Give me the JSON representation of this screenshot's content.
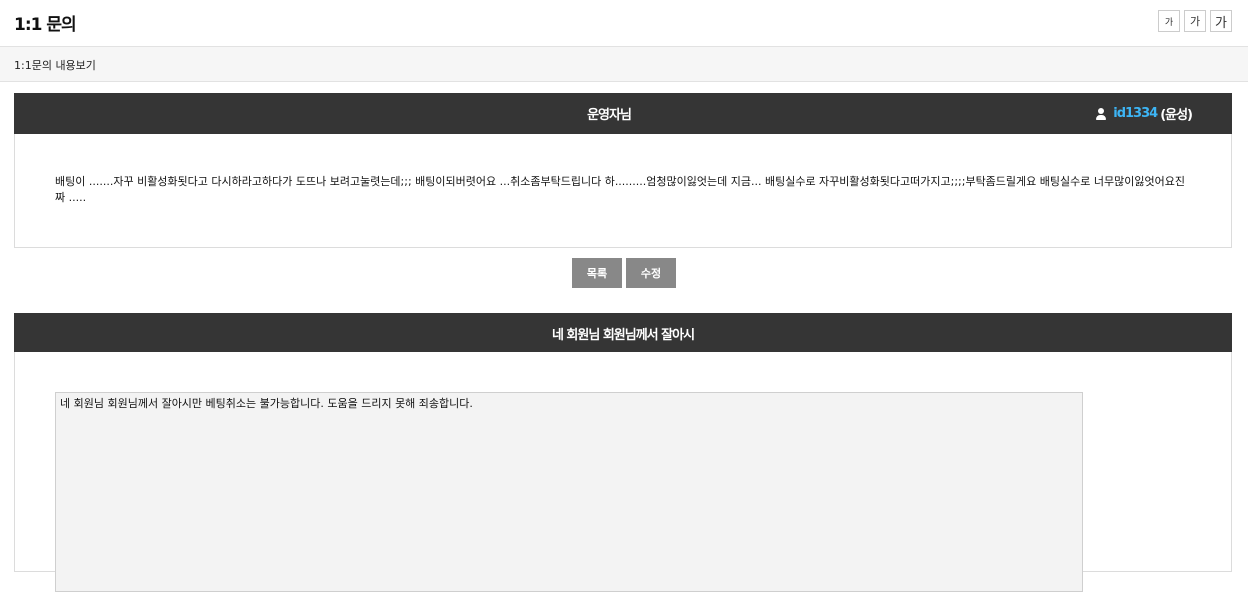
{
  "header": {
    "title": "1:1 문의",
    "font_sizes": [
      "가",
      "가",
      "가"
    ]
  },
  "subbar": {
    "label": "1:1문의 내용보기"
  },
  "question": {
    "title": "운영자님",
    "author_id": "id1334",
    "author_name": "(윤성)",
    "body": "배팅이 .......자꾸 비활성화됫다고 다시하라고하다가 도뜨나 보려고눌렷는데;;; 배팅이되버렷어요 ...취소좀부탁드립니다 하.........엄청많이잃엇는데 지금... 배팅실수로 자꾸비활성화됫다고떠가지고;;;;부탁좀드릴게요 배팅실수로 너무많이잃엇어요진짜 ....."
  },
  "buttons": {
    "list": "목록",
    "edit": "수정"
  },
  "answer": {
    "title": "네 회원님 회원님께서 잘아시",
    "body": "네 회원님 회원님께서 잘아시만 베팅취소는 불가능합니다. 도움을 드리지 못해 죄송합니다."
  },
  "colors": {
    "bar_bg": "#353535",
    "accent": "#3db5f5",
    "button_bg": "#888888"
  }
}
